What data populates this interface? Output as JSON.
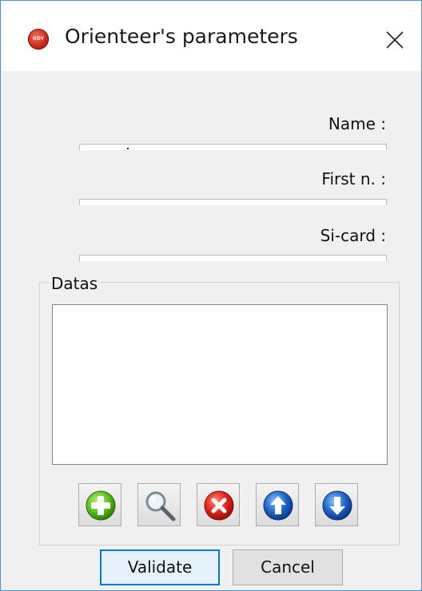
{
  "window": {
    "title": "Orienteer's parameters",
    "app_icon_text": "ODY",
    "accent_color": "#0078d7"
  },
  "form": {
    "name_label": "Name :",
    "name_value": "",
    "first_name_label": "First n. :",
    "first_name_value": "",
    "si_card_label": "Si-card :",
    "si_card_value": ""
  },
  "datas": {
    "group_title": "Datas",
    "items": []
  },
  "toolbar": {
    "icons": [
      "add-icon",
      "search-icon",
      "delete-icon",
      "move-up-icon",
      "move-down-icon"
    ]
  },
  "buttons": {
    "validate_label": "Validate",
    "cancel_label": "Cancel"
  }
}
